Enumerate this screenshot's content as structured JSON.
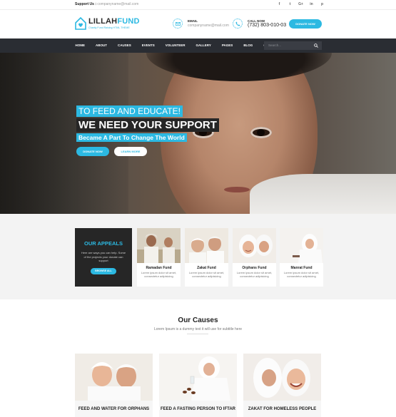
{
  "topbar": {
    "support_label": "Support Us :",
    "support_email": "companyname@mail.com",
    "social": [
      "f",
      "t",
      "G+",
      "in",
      "p"
    ]
  },
  "header": {
    "logo_part1": "LILLAH",
    "logo_part2": "FUND",
    "tagline": "Charity Fund Raising HTML THEME",
    "email_label": "EMAIL",
    "email_value": "companyname@mail.com",
    "call_label": "CALL NOW",
    "call_value": "(732) 803-010-03",
    "donate_label": "DONATE NOW"
  },
  "nav": {
    "items": [
      "HOME",
      "ABOUT",
      "CAUSES",
      "EVENTS",
      "VOLUNTEER",
      "GALLERY",
      "PAGES",
      "BLOG",
      "CONTACT"
    ],
    "search_placeholder": "Search..."
  },
  "hero": {
    "line1": "TO FEED AND EDUCATE!",
    "line2": "WE NEED YOUR SUPPORT",
    "line3": "Became A Part To Change The World",
    "button1": "DONATE NOW",
    "button2": "LEARN MORE"
  },
  "appeals": {
    "title": "OUR APPEALS",
    "description": "Here are ways you can help. Some of the projects your donate can support",
    "button": "BROWSE ALL",
    "funds": [
      {
        "title": "Ramadan Fund",
        "desc": "Lorem ipsum dolor sit amet, consectetur adipisicing"
      },
      {
        "title": "Zakat Fund",
        "desc": "Lorem ipsum dolor sit amet, consectetur adipisicing"
      },
      {
        "title": "Orphans Fund",
        "desc": "Lorem ipsum dolor sit amet, consectetur adipisicing"
      },
      {
        "title": "Manrat Fund",
        "desc": "Lorem ipsum dolor sit amet, consectetur adipisicing"
      }
    ]
  },
  "causes": {
    "title": "Our Causes",
    "subtitle": "Lorem Ipsum is a dummy text it will use for subtitle here",
    "items": [
      {
        "title": "FEED AND WATER FOR ORPHANS"
      },
      {
        "title": "FEED A FASTING PERSON TO IFTAR"
      },
      {
        "title": "ZAKAT FOR HOMELESS PEOPLE"
      }
    ]
  },
  "colors": {
    "accent": "#2cb9e2",
    "dark": "#262626",
    "nav": "#2a2d33"
  }
}
